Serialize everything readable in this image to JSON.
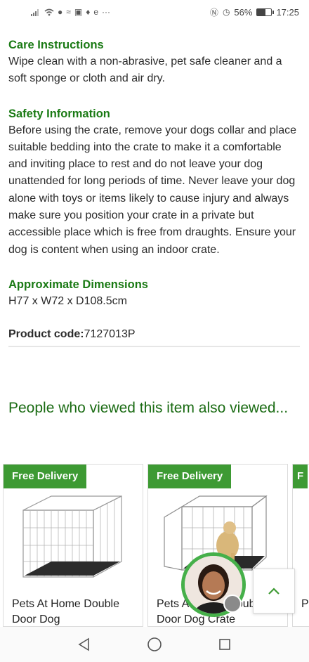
{
  "status_bar": {
    "left_dots": "···",
    "battery_percent": "56%",
    "battery_level": 0.56,
    "time": "17:25"
  },
  "care": {
    "heading": "Care Instructions",
    "body": "Wipe clean with a non-abrasive, pet safe cleaner and a soft sponge or cloth and air dry."
  },
  "safety": {
    "heading": "Safety Information",
    "body": "Before using the crate, remove your dogs collar and place suitable bedding into the crate to make it a comfortable and inviting place to rest and do not leave your dog unattended for long periods of time. Never leave your dog alone with toys or items likely to cause injury and always make sure you position your crate in a private but accessible place which is free from draughts. Ensure your dog is content when using an indoor crate."
  },
  "dimensions": {
    "heading": "Approximate Dimensions",
    "value": "H77 x W72 x D108.5cm"
  },
  "product_code": {
    "label": "Product code:",
    "value": "7127013P"
  },
  "also_viewed": {
    "heading": "People who viewed this item also viewed...",
    "items": [
      {
        "badge": "Free Delivery",
        "title": "Pets At Home Double Door Dog"
      },
      {
        "badge": "Free Delivery",
        "title": "Pets At Home Double Door Dog Crate"
      },
      {
        "badge": "F",
        "title": "P D"
      }
    ]
  },
  "icons": {
    "wifi": "wifi-icon",
    "signal": "signal-icon",
    "nfc": "nfc-icon",
    "alarm": "alarm-icon",
    "battery": "battery-icon",
    "back": "back-triangle-icon",
    "home": "home-circle-icon",
    "recents": "recents-square-icon",
    "scroll_top": "chevron-up-icon"
  },
  "colors": {
    "heading_green": "#1a7a14",
    "badge_green": "#3d9a33",
    "avatar_ring": "#46b04a"
  }
}
